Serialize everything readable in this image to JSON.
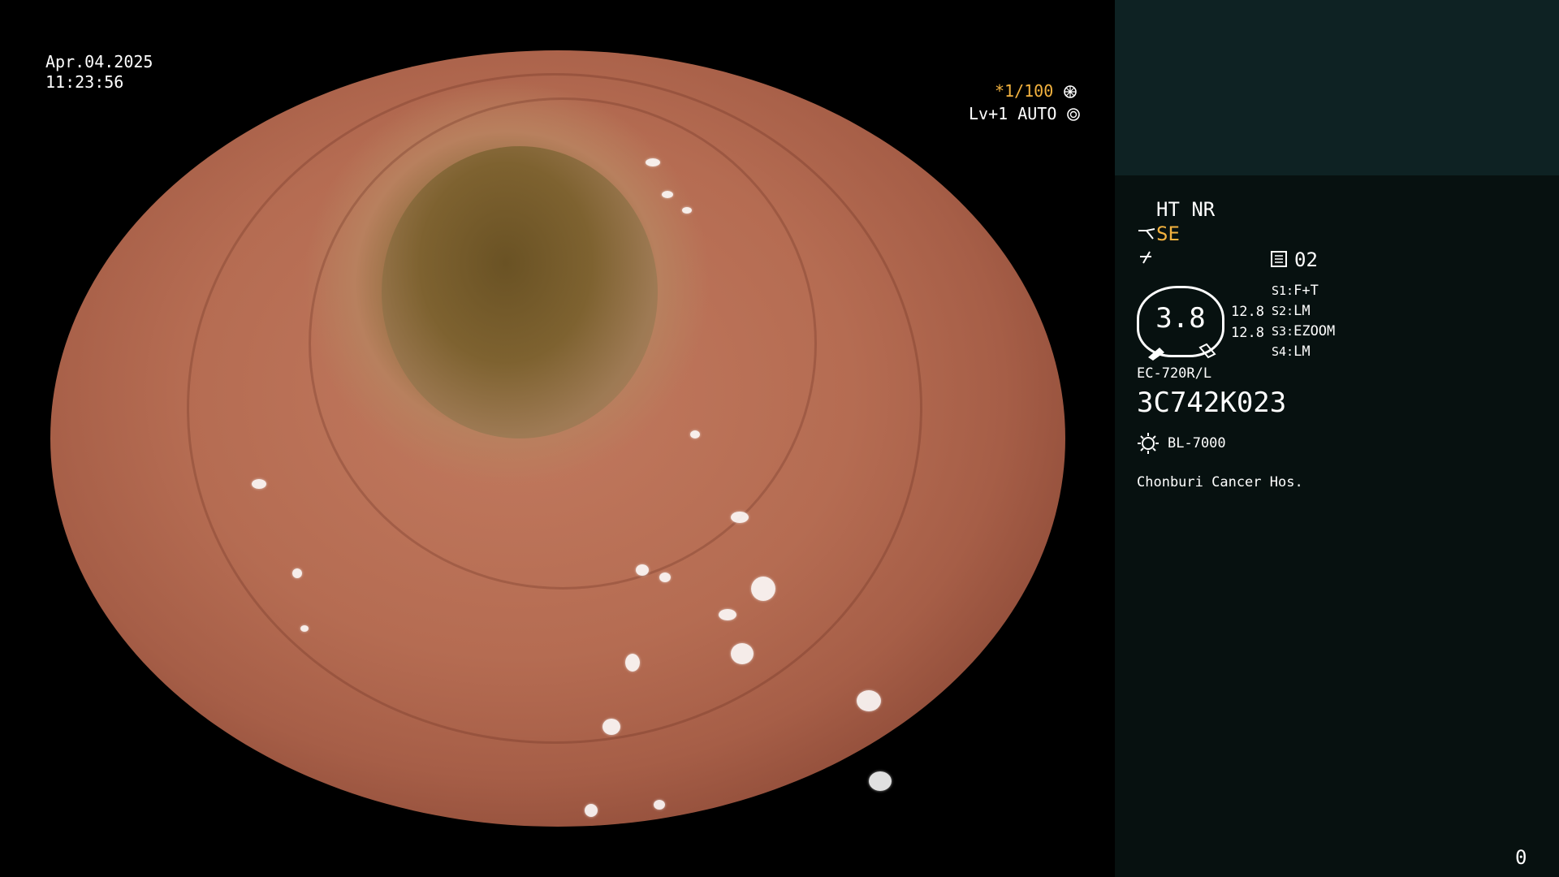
{
  "overlay": {
    "date": "Apr.04.2025",
    "time": "11:23:56",
    "shutter": "*1/100",
    "level": "Lv+1 AUTO"
  },
  "panel": {
    "mode_ht_nr": "HT NR",
    "mode_se": "SE",
    "preset": "02",
    "dial_value": "3.8",
    "dial_side_1": "12.8",
    "dial_side_2": "12.8",
    "switches": [
      {
        "key": "S1:",
        "value": "F+T"
      },
      {
        "key": "S2:",
        "value": "LM"
      },
      {
        "key": "S3:",
        "value": "EZOOM"
      },
      {
        "key": "S4:",
        "value": "LM"
      }
    ],
    "scope_model": "EC-720R/L",
    "scope_serial": "3C742K023",
    "light_source": "BL-7000",
    "hospital": "Chonburi Cancer Hos.",
    "counter": "0"
  },
  "colors": {
    "panel_bg": "#071110",
    "panel_top_bg": "#0e2223",
    "accent_orange": "#f3b23f"
  },
  "icons": [
    "aperture-icon",
    "iris-icon",
    "scope-tip-icon",
    "freeze-icon",
    "memo-icon",
    "lamp-icon"
  ]
}
